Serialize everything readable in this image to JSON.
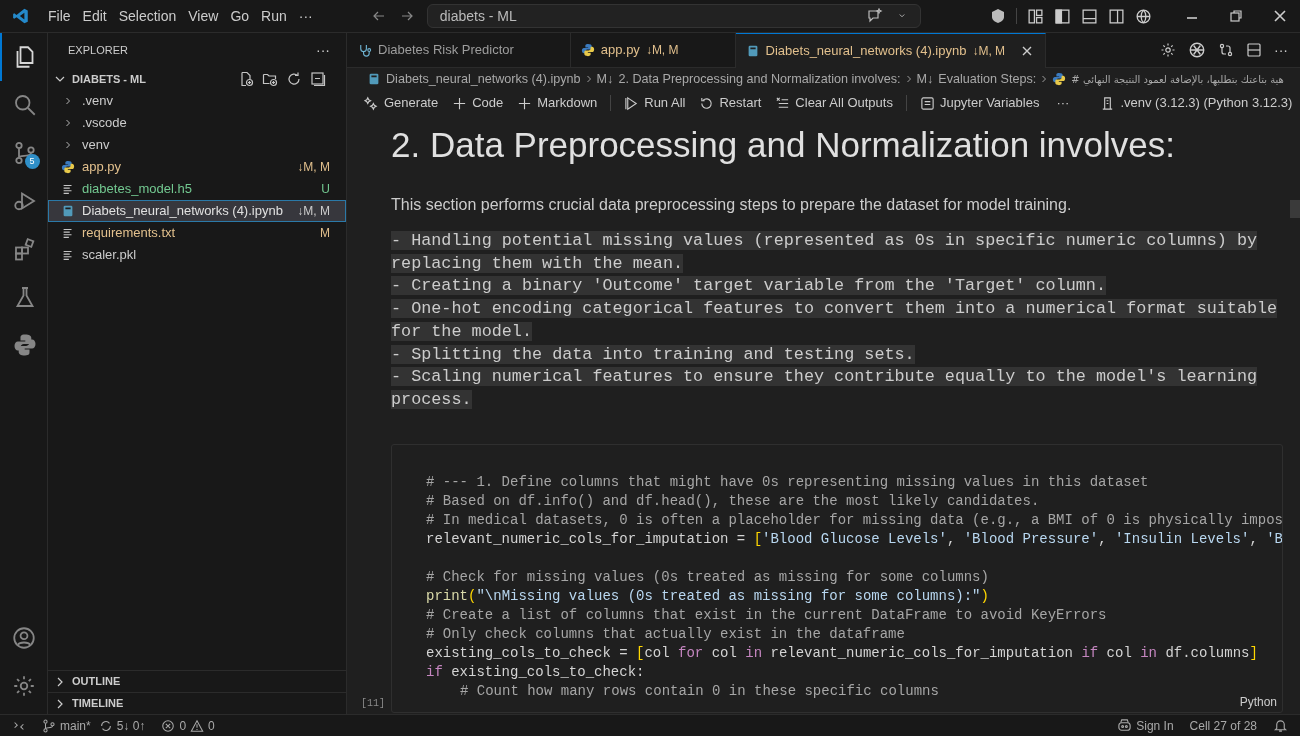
{
  "title_bar": {
    "menu": [
      "File",
      "Edit",
      "Selection",
      "View",
      "Go",
      "Run",
      "···"
    ],
    "search": {
      "value": "diabets - ML"
    }
  },
  "activity_bar": {
    "items": [
      {
        "kind": "files",
        "selected": true
      },
      {
        "kind": "search",
        "selected": false
      },
      {
        "kind": "scm",
        "selected": false,
        "badge": "5"
      },
      {
        "kind": "debug",
        "selected": false
      },
      {
        "kind": "extensions",
        "selected": false
      },
      {
        "kind": "testing",
        "selected": false
      },
      {
        "kind": "python",
        "selected": false
      }
    ]
  },
  "sidebar": {
    "title": "EXPLORER",
    "more": "···",
    "root": {
      "label": "DIABETS - ML",
      "expanded": true,
      "children": [
        {
          "label": ".venv",
          "kind": "folder",
          "selected": false
        },
        {
          "label": ".vscode",
          "kind": "folder",
          "selected": false
        },
        {
          "label": "venv",
          "kind": "folder",
          "selected": false
        },
        {
          "label": "app.py",
          "kind": "python",
          "status": "↓M, M",
          "color": "#e2c08d",
          "selected": false
        },
        {
          "label": "diabetes_model.h5",
          "kind": "file",
          "status": "U",
          "color": "#73c991",
          "selected": false
        },
        {
          "label": "Diabets_neural_networks (4).ipynb",
          "kind": "notebook",
          "status": "↓M, M",
          "selected": true
        },
        {
          "label": "requirements.txt",
          "kind": "file",
          "status": "M",
          "color": "#e2c08d",
          "selected": false
        },
        {
          "label": "scaler.pkl",
          "kind": "file",
          "selected": false
        }
      ]
    },
    "sections": [
      {
        "label": "OUTLINE",
        "expanded": false
      },
      {
        "label": "TIMELINE",
        "expanded": false
      }
    ]
  },
  "tabs": [
    {
      "label": "Diabetes Risk Predictor",
      "kind": "webview",
      "selected": false
    },
    {
      "label": "app.py",
      "status": "↓M, M",
      "kind": "python",
      "selected": false
    },
    {
      "label": "Diabets_neural_networks (4).ipynb",
      "status": "↓M, M",
      "kind": "notebook",
      "selected": true
    }
  ],
  "editor_actions": {
    "more": "···"
  },
  "breadcrumb": [
    {
      "kind": "notebook",
      "label": "Diabets_neural_networks (4).ipynb"
    },
    {
      "kind": "markdown",
      "prefix": "M↓",
      "label": "2. Data Preprocessing and Normalization involves:"
    },
    {
      "kind": "markdown",
      "prefix": "M↓",
      "label": "Evaluation Steps:"
    },
    {
      "kind": "python",
      "label": "# هية بتاعتك بتطلبها، بالإضافة لعمود النتيجة النهائي"
    }
  ],
  "toolbar": [
    {
      "kind": "generate",
      "label": "Generate"
    },
    {
      "kind": "plus",
      "label": "Code"
    },
    {
      "kind": "plus",
      "label": "Markdown"
    },
    {
      "kind": "separator"
    },
    {
      "kind": "run",
      "label": "Run All"
    },
    {
      "kind": "restart",
      "label": "Restart"
    },
    {
      "kind": "clear",
      "label": "Clear All Outputs"
    },
    {
      "kind": "separator"
    },
    {
      "kind": "variables",
      "label": "Jupyter Variables"
    },
    {
      "kind": "more",
      "label": "···"
    },
    {
      "kind": "kernel",
      "label": ".venv (3.12.3) (Python 3.12.3)"
    }
  ],
  "markdown_cell": {
    "heading": "2. Data Preprocessing and Normalization involves:",
    "paragraph": "This section performs crucial data preprocessing steps to prepare the dataset for model training.",
    "code_lines": [
      "- Handling potential missing values (represented as 0s in specific numeric columns) by",
      "replacing them with the mean.",
      "- Creating a binary 'Outcome' target variable from the 'Target' column.",
      "- One-hot encoding categorical features to convert them into a numerical format suitable",
      "for the model.",
      "- Splitting the data into training and testing sets.",
      "- Scaling numerical features to ensure they contribute equally to the model's learning",
      "process."
    ]
  },
  "code_cell": {
    "execution_count": "[11]",
    "language": "Python",
    "lines": [
      {
        "kind": "code",
        "tokens": [
          {
            "kind": "comment",
            "text": "# --- 1. Define columns that might have 0s representing missing values in this dataset"
          }
        ]
      },
      {
        "kind": "code",
        "tokens": [
          {
            "kind": "comment",
            "text": "# Based on df.info() and df.head(), these are the most likely candidates."
          }
        ]
      },
      {
        "kind": "code",
        "tokens": [
          {
            "kind": "comment",
            "text": "# In medical datasets, 0 is often a placeholder for missing data (e.g., a BMI of 0 is physically impos"
          }
        ]
      },
      {
        "kind": "code",
        "tokens": [
          {
            "kind": "plain",
            "text": "relevant_numeric_cols_for_imputation = "
          },
          {
            "kind": "bracket",
            "text": "["
          },
          {
            "kind": "string",
            "text": "'Blood Glucose Levels'"
          },
          {
            "kind": "plain",
            "text": ", "
          },
          {
            "kind": "string",
            "text": "'Blood Pressure'"
          },
          {
            "kind": "plain",
            "text": ", "
          },
          {
            "kind": "string",
            "text": "'Insulin Levels'"
          },
          {
            "kind": "plain",
            "text": ", "
          },
          {
            "kind": "string",
            "text": "'B"
          }
        ]
      },
      {
        "kind": "blank"
      },
      {
        "kind": "code",
        "tokens": [
          {
            "kind": "comment",
            "text": "# Check for missing values (0s treated as missing for some columns)"
          }
        ]
      },
      {
        "kind": "code",
        "tokens": [
          {
            "kind": "function",
            "text": "print"
          },
          {
            "kind": "bracket",
            "text": "("
          },
          {
            "kind": "string",
            "text": "\"\\nMissing values (0s treated as missing for some columns):\""
          },
          {
            "kind": "bracket",
            "text": ")"
          }
        ]
      },
      {
        "kind": "code",
        "tokens": [
          {
            "kind": "comment",
            "text": "# Create a list of columns that exist in the current DataFrame to avoid KeyErrors"
          }
        ]
      },
      {
        "kind": "code",
        "tokens": [
          {
            "kind": "comment",
            "text": "# Only check columns that actually exist in the dataframe"
          }
        ]
      },
      {
        "kind": "code",
        "tokens": [
          {
            "kind": "plain",
            "text": "existing_cols_to_check = "
          },
          {
            "kind": "bracket",
            "text": "["
          },
          {
            "kind": "plain",
            "text": "col "
          },
          {
            "kind": "keyword",
            "text": "for"
          },
          {
            "kind": "plain",
            "text": " col "
          },
          {
            "kind": "keyword",
            "text": "in"
          },
          {
            "kind": "plain",
            "text": " relevant_numeric_cols_for_imputation "
          },
          {
            "kind": "keyword",
            "text": "if"
          },
          {
            "kind": "plain",
            "text": " col "
          },
          {
            "kind": "keyword",
            "text": "in"
          },
          {
            "kind": "plain",
            "text": " df.columns"
          },
          {
            "kind": "bracket",
            "text": "]"
          }
        ]
      },
      {
        "kind": "code",
        "tokens": [
          {
            "kind": "keyword",
            "text": "if"
          },
          {
            "kind": "plain",
            "text": " existing_cols_to_check:"
          }
        ]
      },
      {
        "kind": "indented",
        "tokens": [
          {
            "kind": "comment",
            "text": "# Count how many rows contain 0 in these specific columns"
          }
        ]
      }
    ]
  },
  "status_bar": {
    "branch": "main*",
    "sync": "5↓ 0↑",
    "errors": "0",
    "warnings": "0",
    "sign_in": "Sign In",
    "cell": "Cell 27 of 28"
  }
}
